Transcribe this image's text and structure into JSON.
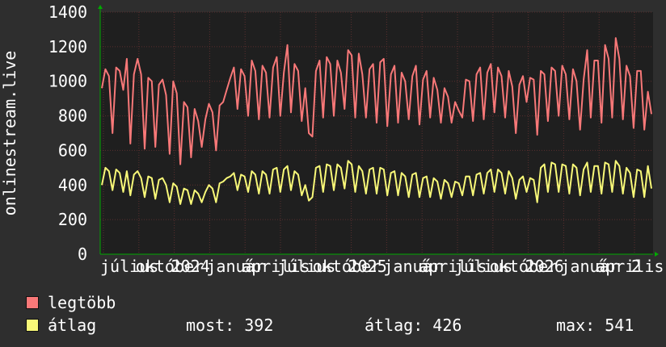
{
  "y_axis_label": "onlinestream.live",
  "legend": [
    {
      "key": "max",
      "label": "legtöbb",
      "color": "#f87878"
    },
    {
      "key": "avg",
      "label": "átlag",
      "color": "#f8f878"
    }
  ],
  "stats": {
    "most_label": "most: 392",
    "avg_label": "átlag: 426",
    "max_label": "max: 541"
  },
  "colors": {
    "background": "#2e2e2e",
    "plot_background": "#1f1f1f",
    "grid": "#5a2f2f",
    "axis": "#00aa00",
    "text": "#ffffff"
  },
  "chart_data": {
    "type": "line",
    "ylabel": "onlinestream.live",
    "ylim": [
      0,
      1400
    ],
    "y_ticks": [
      0,
      200,
      400,
      600,
      800,
      1000,
      1200,
      1400
    ],
    "x_tick_labels": [
      "július",
      "október",
      "2024",
      "január",
      "április",
      "július",
      "október",
      "2025",
      "január",
      "április",
      "július",
      "október",
      "2026",
      "január",
      "április",
      "2"
    ],
    "x_range": [
      "2023-07",
      "2026-05"
    ],
    "grid": true,
    "series": [
      {
        "name": "legtöbb",
        "color": "#f87878",
        "values": [
          960,
          1070,
          1030,
          700,
          1080,
          1060,
          950,
          1130,
          640,
          1040,
          1130,
          1040,
          610,
          1020,
          1000,
          620,
          980,
          1010,
          920,
          580,
          1000,
          930,
          520,
          880,
          850,
          560,
          840,
          770,
          620,
          780,
          870,
          820,
          600,
          860,
          880,
          950,
          1020,
          1080,
          840,
          1070,
          1030,
          800,
          1120,
          1060,
          780,
          1090,
          1050,
          790,
          1080,
          1140,
          800,
          1050,
          1210,
          820,
          1100,
          1060,
          770,
          960,
          700,
          680,
          1060,
          1120,
          790,
          1140,
          1100,
          800,
          1120,
          1050,
          840,
          1180,
          1150,
          790,
          1160,
          1040,
          790,
          1070,
          1100,
          760,
          1110,
          1130,
          740,
          1040,
          1090,
          760,
          1050,
          1000,
          780,
          1030,
          1090,
          750,
          1010,
          1060,
          790,
          1020,
          950,
          760,
          960,
          910,
          760,
          880,
          830,
          790,
          1010,
          1000,
          770,
          1040,
          1080,
          780,
          1050,
          1100,
          820,
          1080,
          1030,
          790,
          1060,
          970,
          700,
          980,
          1030,
          880,
          1020,
          1010,
          690,
          1060,
          1040,
          770,
          1080,
          1060,
          800,
          1090,
          1040,
          780,
          1070,
          1000,
          720,
          1010,
          1180,
          790,
          1120,
          1120,
          760,
          1210,
          1130,
          790,
          1250,
          1130,
          780,
          1090,
          1030,
          730,
          1060,
          1060,
          720,
          940,
          810
        ]
      },
      {
        "name": "átlag",
        "color": "#f8f878",
        "values": [
          400,
          500,
          480,
          370,
          490,
          470,
          360,
          480,
          340,
          460,
          480,
          440,
          330,
          450,
          440,
          320,
          430,
          440,
          400,
          300,
          410,
          390,
          290,
          380,
          370,
          290,
          370,
          350,
          300,
          360,
          400,
          380,
          300,
          410,
          420,
          440,
          450,
          470,
          370,
          460,
          450,
          360,
          480,
          460,
          350,
          480,
          460,
          350,
          490,
          500,
          360,
          490,
          510,
          370,
          480,
          460,
          340,
          400,
          310,
          330,
          500,
          510,
          360,
          520,
          510,
          370,
          520,
          500,
          380,
          540,
          520,
          360,
          510,
          480,
          350,
          490,
          500,
          350,
          500,
          490,
          340,
          470,
          480,
          340,
          470,
          450,
          330,
          460,
          470,
          330,
          440,
          450,
          330,
          440,
          420,
          320,
          430,
          410,
          330,
          420,
          410,
          340,
          450,
          450,
          340,
          460,
          470,
          350,
          470,
          490,
          360,
          490,
          470,
          350,
          480,
          440,
          320,
          430,
          450,
          360,
          440,
          430,
          300,
          500,
          520,
          360,
          530,
          520,
          360,
          520,
          510,
          350,
          520,
          500,
          340,
          490,
          530,
          360,
          510,
          510,
          350,
          530,
          520,
          360,
          540,
          510,
          350,
          500,
          470,
          330,
          490,
          480,
          330,
          510,
          380
        ]
      }
    ]
  }
}
